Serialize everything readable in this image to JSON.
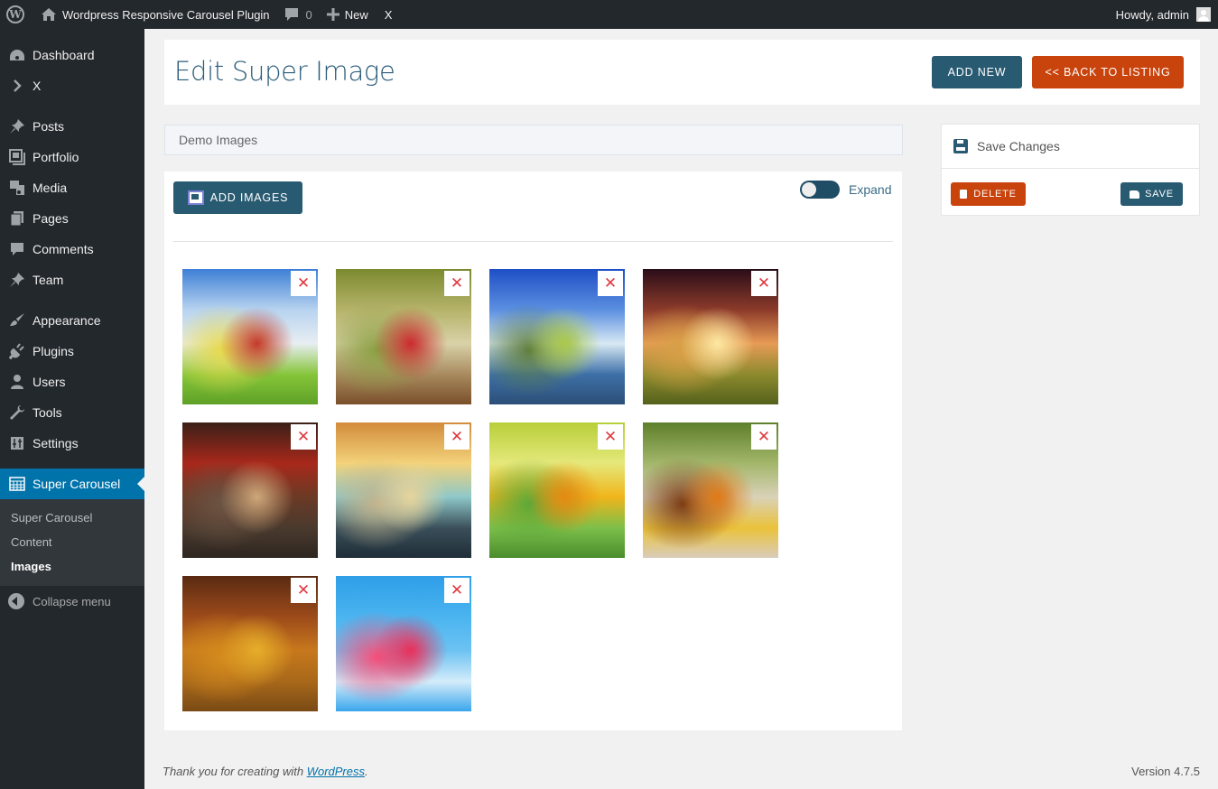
{
  "adminbar": {
    "site_name": "Wordpress Responsive Carousel Plugin",
    "comments_count": "0",
    "new_label": "New",
    "x_label": "X",
    "greeting": "Howdy, admin"
  },
  "sidebar": {
    "items": [
      {
        "label": "Dashboard",
        "icon": "dashboard-icon"
      },
      {
        "label": "X",
        "icon": "chevron-right-icon"
      },
      {
        "label": "Posts",
        "icon": "pin-icon"
      },
      {
        "label": "Portfolio",
        "icon": "portfolio-icon"
      },
      {
        "label": "Media",
        "icon": "media-icon"
      },
      {
        "label": "Pages",
        "icon": "pages-icon"
      },
      {
        "label": "Comments",
        "icon": "comment-icon"
      },
      {
        "label": "Team",
        "icon": "pin-icon"
      },
      {
        "label": "Appearance",
        "icon": "brush-icon"
      },
      {
        "label": "Plugins",
        "icon": "plug-icon"
      },
      {
        "label": "Users",
        "icon": "user-icon"
      },
      {
        "label": "Tools",
        "icon": "wrench-icon"
      },
      {
        "label": "Settings",
        "icon": "settings-icon"
      },
      {
        "label": "Super Carousel",
        "icon": "carousel-icon"
      }
    ],
    "submenu": [
      "Super Carousel",
      "Content",
      "Images"
    ],
    "collapse_label": "Collapse menu"
  },
  "header": {
    "title": "Edit Super Image",
    "add_new_label": "ADD NEW",
    "back_label": "<< BACK TO LISTING"
  },
  "gallery": {
    "name_value": "Demo Images",
    "add_images_label": "ADD IMAGES",
    "expand_label": "Expand",
    "expand_on": true,
    "images": [
      {
        "name": "girls-in-hats-field",
        "colors": [
          "#3e7fd6",
          "#b7d3ef",
          "#e8eef2",
          "#c43a2b",
          "#e6d94a",
          "#86c53a",
          "#5ea126"
        ]
      },
      {
        "name": "flower-bicycle",
        "colors": [
          "#7c8a2e",
          "#b5b36a",
          "#d9d2a8",
          "#cc2a2f",
          "#8aa042",
          "#a88a5e",
          "#7a4f2a"
        ]
      },
      {
        "name": "eiffel-tower",
        "colors": [
          "#1f4fc6",
          "#5b8fe0",
          "#d8e9f4",
          "#a9c84a",
          "#5e7d3b",
          "#3d6fa6",
          "#2c4f78"
        ]
      },
      {
        "name": "sunset-truck",
        "colors": [
          "#2a0d18",
          "#8c3a2a",
          "#e79b55",
          "#fde8a2",
          "#d7a046",
          "#8c8a2d",
          "#55611c"
        ]
      },
      {
        "name": "horse-autumn",
        "colors": [
          "#3a2017",
          "#a8281b",
          "#6b3a25",
          "#cfa77a",
          "#6b5444",
          "#4a3a2e",
          "#2e2620"
        ]
      },
      {
        "name": "railway-sunset",
        "colors": [
          "#d28b3b",
          "#f3d27a",
          "#8ec8c8",
          "#e7d49c",
          "#c2b48c",
          "#3a4f5a",
          "#1f2e37"
        ]
      },
      {
        "name": "yellow-crocus",
        "colors": [
          "#b7cf3a",
          "#e5e87a",
          "#f0b51b",
          "#e58a12",
          "#5aa839",
          "#7cbf4a",
          "#4a8c2c"
        ]
      },
      {
        "name": "monarch-butterfly",
        "colors": [
          "#5d7f2b",
          "#a3b66a",
          "#d9d2b8",
          "#e07a16",
          "#7a3a12",
          "#eac23a",
          "#d9ccbb"
        ]
      },
      {
        "name": "autumn-bench",
        "colors": [
          "#5a2a12",
          "#9c4a1a",
          "#c7781c",
          "#e6ad2a",
          "#d48b1d",
          "#a8681a",
          "#7a4a15"
        ]
      },
      {
        "name": "pink-gerbera",
        "colors": [
          "#2f9ee8",
          "#4ab4f0",
          "#6cc2f2",
          "#e8305a",
          "#f5507a",
          "#d4ecfa",
          "#3aa6ec"
        ]
      }
    ],
    "remove_glyph": "✕"
  },
  "savebox": {
    "title": "Save Changes",
    "delete_label": "DELETE",
    "save_label": "SAVE"
  },
  "footer": {
    "thanks_prefix": "Thank you for creating with ",
    "thanks_link": "WordPress",
    "thanks_suffix": ".",
    "version": "Version 4.7.5"
  },
  "colors": {
    "primary": "#285a72",
    "danger": "#c9430d",
    "wp_active": "#0073aa",
    "admin_dark": "#23282d"
  }
}
